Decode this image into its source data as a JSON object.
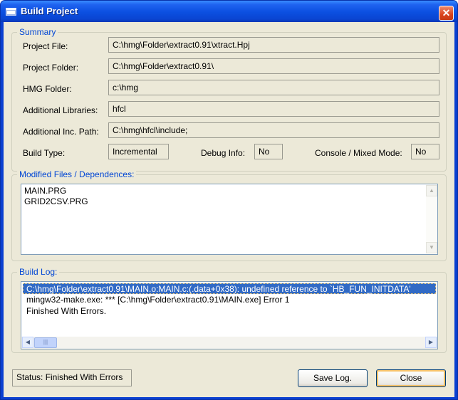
{
  "window": {
    "title": "Build Project",
    "close_glyph": "✕"
  },
  "summary": {
    "legend": "Summary",
    "project_file_label": "Project File:",
    "project_file_value": "C:\\hmg\\Folder\\extract0.91\\xtract.Hpj",
    "project_folder_label": "Project Folder:",
    "project_folder_value": "C:\\hmg\\Folder\\extract0.91\\",
    "hmg_folder_label": "HMG Folder:",
    "hmg_folder_value": "c:\\hmg",
    "additional_libraries_label": "Additional Libraries:",
    "additional_libraries_value": "hfcl",
    "additional_inc_path_label": "Additional Inc. Path:",
    "additional_inc_path_value": "C:\\hmg\\hfcl\\include;",
    "build_type_label": "Build Type:",
    "build_type_value": "Incremental",
    "debug_info_label": "Debug Info:",
    "debug_info_value": "No",
    "console_mode_label": "Console / Mixed Mode:",
    "console_mode_value": "No"
  },
  "modified_files": {
    "legend": "Modified Files / Dependences:",
    "items": [
      "MAIN.PRG",
      "GRID2CSV.PRG"
    ]
  },
  "build_log": {
    "legend": "Build Log:",
    "lines": [
      "C:\\hmg\\Folder\\extract0.91\\MAIN.o:MAIN.c:(.data+0x38): undefined reference to `HB_FUN_INITDATA'",
      "mingw32-make.exe: *** [C:\\hmg\\Folder\\extract0.91\\MAIN.exe] Error 1",
      "Finished With Errors."
    ],
    "selected_index": 0,
    "highlight_color": "#316ac5"
  },
  "footer": {
    "status_text": "Status: Finished With Errors",
    "save_log_label": "Save Log.",
    "close_label": "Close"
  },
  "icons": {
    "window_icon": "window-icon",
    "scroll_up": "▲",
    "scroll_down": "▼",
    "scroll_left": "◀",
    "scroll_right": "▶",
    "grip": "|||"
  }
}
